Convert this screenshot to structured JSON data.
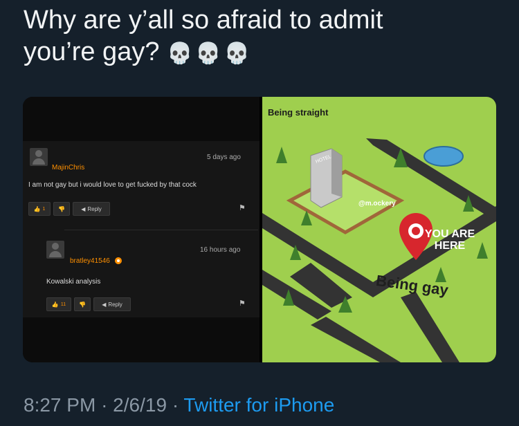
{
  "tweet": {
    "text_line1": "Why are y’all so afraid to admit",
    "text_line2": "you’re gay?",
    "emoji": "💀💀💀",
    "time": "8:27 PM",
    "date": "2/6/19",
    "separator": "·",
    "source": "Twitter for iPhone"
  },
  "comments": [
    {
      "username": "MajinChris",
      "time_ago": "5 days ago",
      "text": "I am not gay but i would love to get fucked by that cock",
      "likes": "1",
      "reply_label": "Reply"
    },
    {
      "username": "bratley41546",
      "time_ago": "16 hours ago",
      "text": "Kowalski analysis",
      "likes": "11",
      "reply_label": "Reply"
    }
  ],
  "map": {
    "title": "Being straight",
    "hotel_sign": "HOTEL",
    "watermark": "@m.ockery",
    "you_are_here": "YOU ARE HERE",
    "being_gay": "Being gay"
  },
  "colors": {
    "background": "#15202b",
    "link": "#1d9bf0",
    "username": "#ff9000",
    "map_green": "#9fcf4e",
    "pin_red": "#d7262d"
  }
}
